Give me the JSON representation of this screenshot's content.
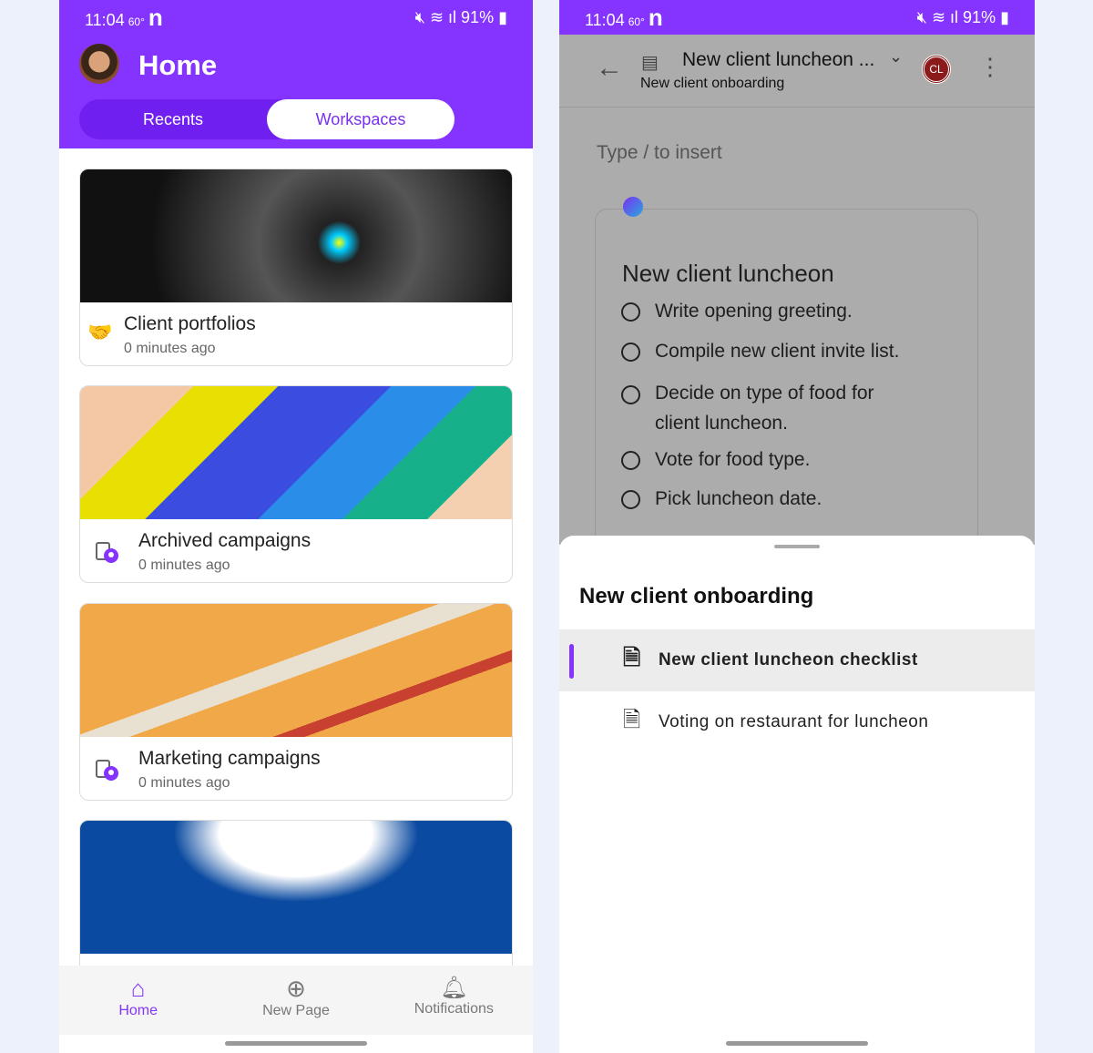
{
  "status": {
    "time": "11:04",
    "temp": "60°",
    "battery": "91%"
  },
  "home": {
    "title": "Home",
    "tabs": [
      {
        "label": "Recents",
        "active": false
      },
      {
        "label": "Workspaces",
        "active": true
      }
    ],
    "cards": [
      {
        "title": "Client portfolios",
        "subtitle": "0 minutes ago",
        "icon": "handshake-icon"
      },
      {
        "title": "Archived campaigns",
        "subtitle": "0 minutes ago",
        "icon": "loop-workspace-icon"
      },
      {
        "title": "Marketing campaigns",
        "subtitle": "0 minutes ago",
        "icon": "loop-workspace-icon"
      }
    ],
    "nav": [
      {
        "label": "Home",
        "icon": "home-icon",
        "active": true
      },
      {
        "label": "New Page",
        "icon": "plus-circle-icon"
      },
      {
        "label": "Notifications",
        "icon": "bell-icon"
      }
    ]
  },
  "page": {
    "title": "New client luncheon ...",
    "workspace": "New client onboarding",
    "avatar_initials": "CL",
    "placeholder": "Type / to insert",
    "component_title": "New client luncheon",
    "checklist": [
      "Write opening greeting.",
      "Compile new client invite list.",
      "Decide on type of food for client luncheon.",
      "Vote for food type.",
      "Pick luncheon date."
    ]
  },
  "sheet": {
    "title": "New client onboarding",
    "items": [
      {
        "label": "New client luncheon checklist",
        "selected": true
      },
      {
        "label": "Voting on restaurant for luncheon",
        "selected": false
      }
    ]
  },
  "colors": {
    "accent": "#8533ff"
  }
}
